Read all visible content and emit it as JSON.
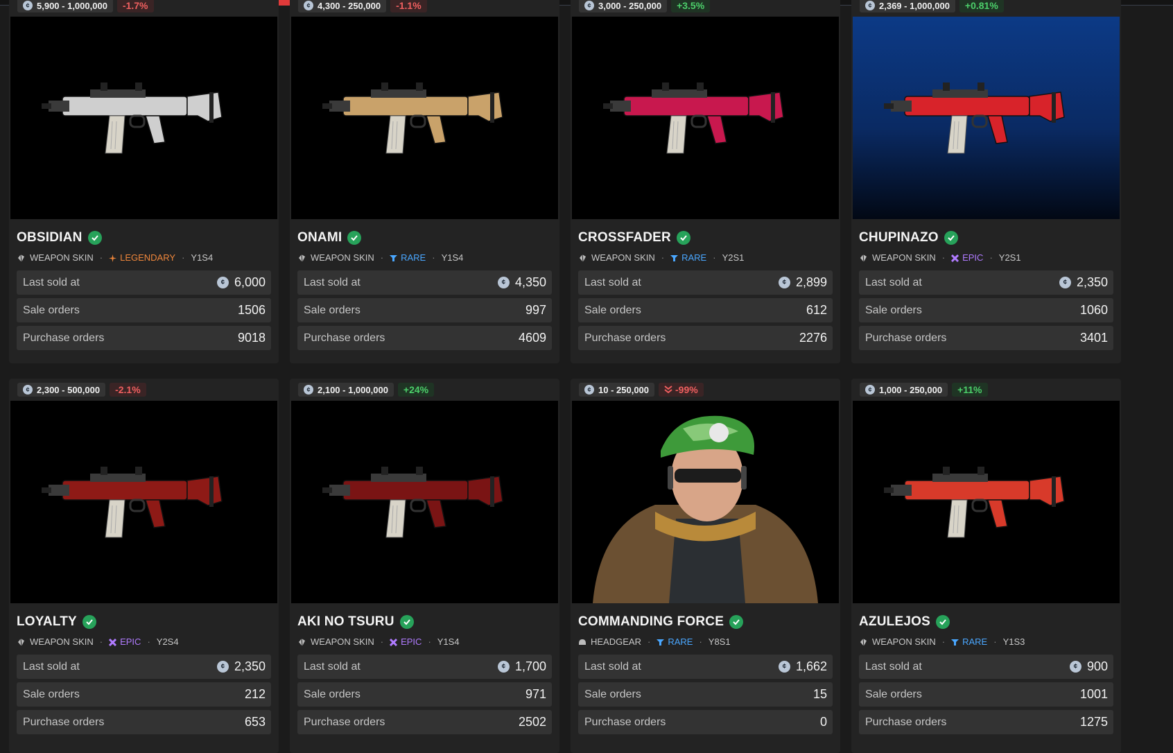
{
  "cards": [
    {
      "range": "5,900 - 1,000,000",
      "change": "-1.7%",
      "change_dir": "neg",
      "name": "OBSIDIAN",
      "type": "WEAPON SKIN",
      "type_icon": "weapon-skin-icon",
      "rarity": "LEGENDARY",
      "rarity_class": "legendary",
      "rarity_icon": "legendary-star-icon",
      "season": "Y1S4",
      "last_sold_label": "Last sold at",
      "last_sold": "6,000",
      "sale_orders_label": "Sale orders",
      "sale_orders": "1506",
      "purchase_orders_label": "Purchase orders",
      "purchase_orders": "9018",
      "image": "obsidian-rifle",
      "accent": "#cfcfcf"
    },
    {
      "range": "4,300 - 250,000",
      "change": "-1.1%",
      "change_dir": "neg",
      "name": "ONAMI",
      "type": "WEAPON SKIN",
      "type_icon": "weapon-skin-icon",
      "rarity": "RARE",
      "rarity_class": "rare",
      "rarity_icon": "rare-funnel-icon",
      "season": "Y1S4",
      "last_sold_label": "Last sold at",
      "last_sold": "4,350",
      "sale_orders_label": "Sale orders",
      "sale_orders": "997",
      "purchase_orders_label": "Purchase orders",
      "purchase_orders": "4609",
      "image": "onami-rifle",
      "accent": "#c9a26a"
    },
    {
      "range": "3,000 - 250,000",
      "change": "+3.5%",
      "change_dir": "pos",
      "name": "CROSSFADER",
      "type": "WEAPON SKIN",
      "type_icon": "weapon-skin-icon",
      "rarity": "RARE",
      "rarity_class": "rare",
      "rarity_icon": "rare-funnel-icon",
      "season": "Y2S1",
      "last_sold_label": "Last sold at",
      "last_sold": "2,899",
      "sale_orders_label": "Sale orders",
      "sale_orders": "612",
      "purchase_orders_label": "Purchase orders",
      "purchase_orders": "2276",
      "image": "crossfader-rifle",
      "accent": "#c8184e"
    },
    {
      "range": "2,369 - 1,000,000",
      "change": "+0.81%",
      "change_dir": "pos",
      "name": "CHUPINAZO",
      "type": "WEAPON SKIN",
      "type_icon": "weapon-skin-icon",
      "rarity": "EPIC",
      "rarity_class": "epic",
      "rarity_icon": "epic-cross-icon",
      "season": "Y2S1",
      "last_sold_label": "Last sold at",
      "last_sold": "2,350",
      "sale_orders_label": "Sale orders",
      "sale_orders": "1060",
      "purchase_orders_label": "Purchase orders",
      "purchase_orders": "3401",
      "image": "chupinazo-rifle",
      "accent": "#d8232a"
    },
    {
      "range": "2,300 - 500,000",
      "change": "-2.1%",
      "change_dir": "neg",
      "name": "LOYALTY",
      "type": "WEAPON SKIN",
      "type_icon": "weapon-skin-icon",
      "rarity": "EPIC",
      "rarity_class": "epic",
      "rarity_icon": "epic-cross-icon",
      "season": "Y2S4",
      "last_sold_label": "Last sold at",
      "last_sold": "2,350",
      "sale_orders_label": "Sale orders",
      "sale_orders": "212",
      "purchase_orders_label": "Purchase orders",
      "purchase_orders": "653",
      "image": "loyalty-rifle",
      "accent": "#8e1a16"
    },
    {
      "range": "2,100 - 1,000,000",
      "change": "+24%",
      "change_dir": "pos",
      "name": "AKI NO TSURU",
      "type": "WEAPON SKIN",
      "type_icon": "weapon-skin-icon",
      "rarity": "EPIC",
      "rarity_class": "epic",
      "rarity_icon": "epic-cross-icon",
      "season": "Y1S4",
      "last_sold_label": "Last sold at",
      "last_sold": "1,700",
      "sale_orders_label": "Sale orders",
      "sale_orders": "971",
      "purchase_orders_label": "Purchase orders",
      "purchase_orders": "2502",
      "image": "aki-no-tsuru-rifle",
      "accent": "#7a1414"
    },
    {
      "range": "10 - 250,000",
      "change": "-99%",
      "change_dir": "neg",
      "change_icon": "double-chevron-down-icon",
      "name": "COMMANDING FORCE",
      "type": "HEADGEAR",
      "type_icon": "headgear-icon",
      "rarity": "RARE",
      "rarity_class": "rare",
      "rarity_icon": "rare-funnel-icon",
      "season": "Y8S1",
      "last_sold_label": "Last sold at",
      "last_sold": "1,662",
      "sale_orders_label": "Sale orders",
      "sale_orders": "15",
      "purchase_orders_label": "Purchase orders",
      "purchase_orders": "0",
      "image": "commanding-force-operator",
      "accent": "#3e9a3a"
    },
    {
      "range": "1,000 - 250,000",
      "change": "+11%",
      "change_dir": "pos",
      "name": "AZULEJOS",
      "type": "WEAPON SKIN",
      "type_icon": "weapon-skin-icon",
      "rarity": "RARE",
      "rarity_class": "rare",
      "rarity_icon": "rare-funnel-icon",
      "season": "Y1S3",
      "last_sold_label": "Last sold at",
      "last_sold": "900",
      "sale_orders_label": "Sale orders",
      "sale_orders": "1001",
      "purchase_orders_label": "Purchase orders",
      "purchase_orders": "1275",
      "image": "azulejos-rifle",
      "accent": "#d83a2a"
    }
  ]
}
